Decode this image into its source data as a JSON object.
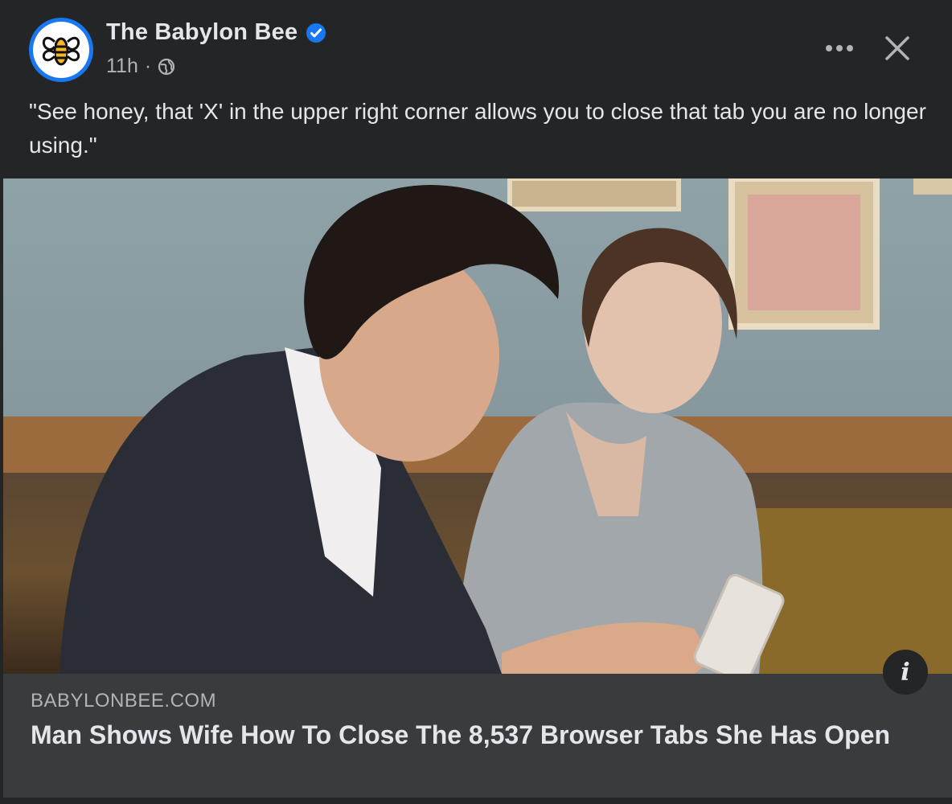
{
  "post": {
    "page_name": "The Babylon Bee",
    "timestamp": "11h",
    "separator": "·",
    "caption": "\"See honey, that 'X' in the upper right corner allows you to close that tab you are no longer using.\"",
    "more_label": "•••",
    "close_label": "✕",
    "icons": {
      "avatar": "babylon-bee-logo",
      "verified": "verified-badge-icon",
      "privacy": "globe-icon",
      "more": "more-options-icon",
      "close": "close-icon",
      "info": "info-icon"
    }
  },
  "link": {
    "domain": "BABYLONBEE.COM",
    "headline": "Man Shows Wife How To Close The 8,537 Browser Tabs She Has Open",
    "info_label": "i"
  },
  "colors": {
    "background": "#242526",
    "preview_background": "#3a3b3c",
    "accent": "#1877f2",
    "primary_text": "#e4e6eb",
    "secondary_text": "#b0b3b8"
  }
}
